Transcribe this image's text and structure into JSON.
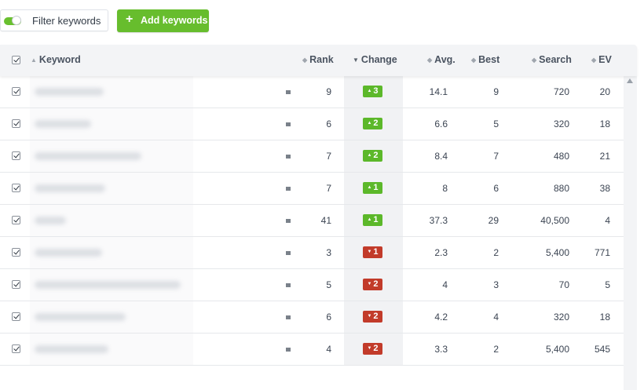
{
  "toolbar": {
    "filter_label": "Filter keywords",
    "filter_enabled": true,
    "add_label": "Add keywords",
    "add_icon": "plus-icon"
  },
  "colors": {
    "accent_green": "#67bd2d",
    "badge_up": "#5cb82a",
    "badge_down": "#c23b2a"
  },
  "table": {
    "columns": {
      "keyword": "Keyword",
      "rank": "Rank",
      "change": "Change",
      "avg": "Avg.",
      "best": "Best",
      "search": "Search",
      "ev": "EV"
    },
    "rows": [
      {
        "rank": "9",
        "change": "3",
        "direction": "up",
        "avg": "14.1",
        "best": "9",
        "search": "720",
        "ev": "20"
      },
      {
        "rank": "6",
        "change": "2",
        "direction": "up",
        "avg": "6.6",
        "best": "5",
        "search": "320",
        "ev": "18"
      },
      {
        "rank": "7",
        "change": "2",
        "direction": "up",
        "avg": "8.4",
        "best": "7",
        "search": "480",
        "ev": "21"
      },
      {
        "rank": "7",
        "change": "1",
        "direction": "up",
        "avg": "8",
        "best": "6",
        "search": "880",
        "ev": "38"
      },
      {
        "rank": "41",
        "change": "1",
        "direction": "up",
        "avg": "37.3",
        "best": "29",
        "search": "40,500",
        "ev": "4"
      },
      {
        "rank": "3",
        "change": "1",
        "direction": "down",
        "avg": "2.3",
        "best": "2",
        "search": "5,400",
        "ev": "771"
      },
      {
        "rank": "5",
        "change": "2",
        "direction": "down",
        "avg": "4",
        "best": "3",
        "search": "70",
        "ev": "5"
      },
      {
        "rank": "6",
        "change": "2",
        "direction": "down",
        "avg": "4.2",
        "best": "4",
        "search": "320",
        "ev": "18"
      },
      {
        "rank": "4",
        "change": "2",
        "direction": "down",
        "avg": "3.3",
        "best": "2",
        "search": "5,400",
        "ev": "545"
      }
    ]
  }
}
